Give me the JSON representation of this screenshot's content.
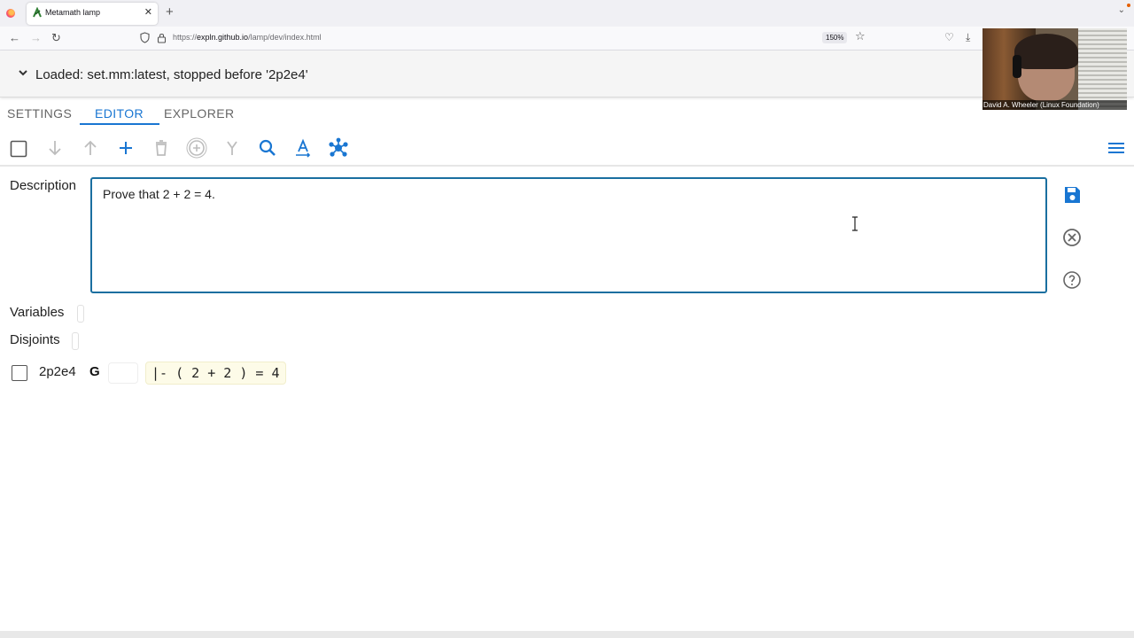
{
  "browser": {
    "tab_title": "Metamath lamp",
    "url_prefix": "https://",
    "url_host": "expln.github.io",
    "url_path": "/lamp/dev/index.html",
    "zoom": "150%"
  },
  "header": {
    "loaded_text": "Loaded: set.mm:latest, stopped before '2p2e4'"
  },
  "tabs": [
    {
      "label": "SETTINGS"
    },
    {
      "label": "EDITOR"
    },
    {
      "label": "EXPLORER"
    }
  ],
  "active_tab": "EDITOR",
  "toolbar": {
    "icons": [
      "checkbox-icon",
      "arrow-down-icon",
      "arrow-up-icon",
      "add-icon",
      "delete-icon",
      "add-circle-icon",
      "merge-icon",
      "search-icon",
      "text-substitution-icon",
      "hub-icon",
      "menu-icon"
    ]
  },
  "editor": {
    "description_label": "Description",
    "description_text": "Prove that 2 + 2 = 4.",
    "variables_label": "Variables",
    "disjoints_label": "Disjoints"
  },
  "step": {
    "label": "2p2e4",
    "type": "G",
    "expression": "|- ( 2 + 2 ) = 4"
  },
  "webcam": {
    "caption": "David A. Wheeler (Linux Foundation)"
  },
  "colors": {
    "accent": "#1976d2",
    "description_border": "#1a6fa0",
    "expression_bg": "#fdfbe8"
  }
}
